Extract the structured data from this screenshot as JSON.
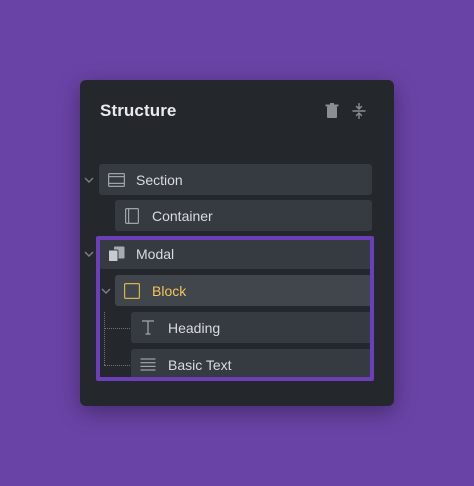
{
  "panel": {
    "title": "Structure",
    "tools": {
      "delete_icon": "trash-icon",
      "collapse_icon": "collapse-all-icon"
    }
  },
  "tree": [
    {
      "label": "Section",
      "icon": "section-icon",
      "expanded": true,
      "depth": 0
    },
    {
      "label": "Container",
      "icon": "container-icon",
      "depth": 1
    },
    {
      "label": "Modal",
      "icon": "modal-icon",
      "expanded": true,
      "depth": 0
    },
    {
      "label": "Block",
      "icon": "block-icon",
      "expanded": true,
      "selected": true,
      "depth": 1
    },
    {
      "label": "Heading",
      "icon": "heading-icon",
      "depth": 2
    },
    {
      "label": "Basic Text",
      "icon": "text-icon",
      "depth": 2
    }
  ],
  "colors": {
    "background": "#6a43a6",
    "panel": "#24272b",
    "row": "#363b41",
    "selected_label": "#f1c65b",
    "highlight_border": "#6c3fb8"
  }
}
